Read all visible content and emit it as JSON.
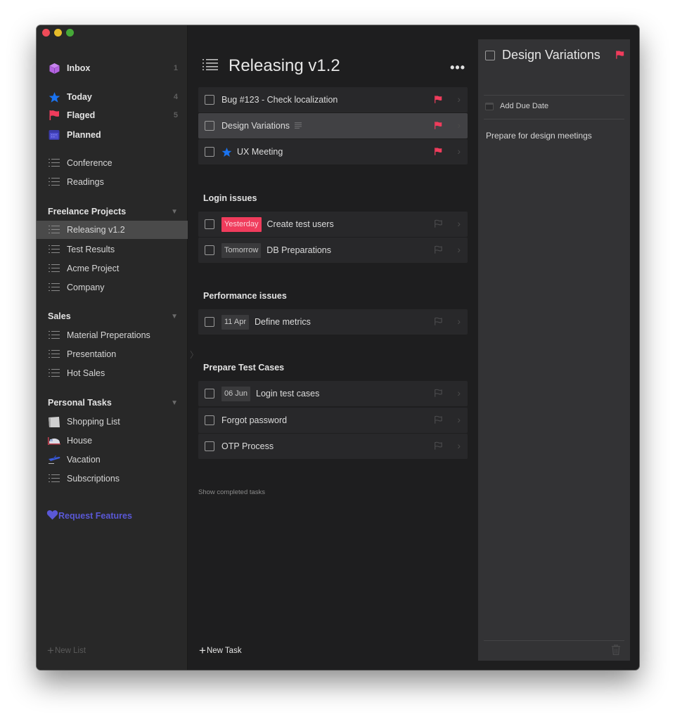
{
  "window": {
    "controls": [
      "close",
      "minimize",
      "maximize"
    ]
  },
  "sidebar": {
    "smart_lists": [
      {
        "label": "Inbox",
        "icon": "cube-icon",
        "count": "1"
      },
      {
        "label": "Today",
        "icon": "star-icon",
        "count": "4"
      },
      {
        "label": "Flaged",
        "icon": "flag-icon",
        "count": "5"
      },
      {
        "label": "Planned",
        "icon": "calendar-icon",
        "count": ""
      }
    ],
    "lists": [
      {
        "label": "Conference",
        "icon": "list-icon"
      },
      {
        "label": "Readings",
        "icon": "list-icon"
      }
    ],
    "groups": [
      {
        "title": "Freelance Projects",
        "items": [
          {
            "label": "Releasing v1.2",
            "icon": "list-icon",
            "selected": true
          },
          {
            "label": "Test Results",
            "icon": "list-icon"
          },
          {
            "label": "Acme Project",
            "icon": "list-icon"
          },
          {
            "label": "Company",
            "icon": "list-icon"
          }
        ]
      },
      {
        "title": "Sales",
        "items": [
          {
            "label": "Material Preperations",
            "icon": "list-icon"
          },
          {
            "label": "Presentation",
            "icon": "list-icon"
          },
          {
            "label": "Hot Sales",
            "icon": "list-icon"
          }
        ]
      },
      {
        "title": "Personal Tasks",
        "items": [
          {
            "label": "Shopping List",
            "icon": "paper-bag-icon"
          },
          {
            "label": "House",
            "icon": "bed-icon"
          },
          {
            "label": "Vacation",
            "icon": "airplane-icon"
          },
          {
            "label": "Subscriptions",
            "icon": "list-icon"
          }
        ]
      }
    ],
    "request_features": "Request Features",
    "new_list": "New List"
  },
  "main": {
    "title": "Releasing v1.2",
    "more_label": "•••",
    "tasks": [
      {
        "name": "Bug #123 - Check localization",
        "flagged": true
      },
      {
        "name": "Design Variations",
        "flagged": true,
        "has_notes": true,
        "selected": true
      },
      {
        "name": "UX Meeting",
        "flagged": true,
        "starred": true
      }
    ],
    "sections": [
      {
        "title": "Login issues",
        "tasks": [
          {
            "name": "Create test users",
            "tag": "Yesterday",
            "tag_style": "red",
            "flagged": false
          },
          {
            "name": "DB Preparations",
            "tag": "Tomorrow",
            "tag_style": "grey",
            "flagged": false
          }
        ]
      },
      {
        "title": "Performance issues",
        "tasks": [
          {
            "name": "Define metrics",
            "tag": "11 Apr",
            "tag_style": "grey",
            "flagged": false
          }
        ]
      },
      {
        "title": "Prepare Test Cases",
        "tasks": [
          {
            "name": "Login test cases",
            "tag": "06 Jun",
            "tag_style": "grey",
            "flagged": false
          },
          {
            "name": "Forgot password",
            "flagged": false
          },
          {
            "name": "OTP Process",
            "flagged": false
          }
        ]
      }
    ],
    "show_completed": "Show completed tasks",
    "new_task": "New Task"
  },
  "detail": {
    "title": "Design Variations",
    "flagged": true,
    "add_due_date": "Add Due Date",
    "notes": "Prepare for design meetings"
  },
  "colors": {
    "accent_red": "#f03c5c",
    "accent_blue": "#1a73f0",
    "accent_purple": "#5a58d6",
    "inbox_purple": "#b363e0"
  }
}
